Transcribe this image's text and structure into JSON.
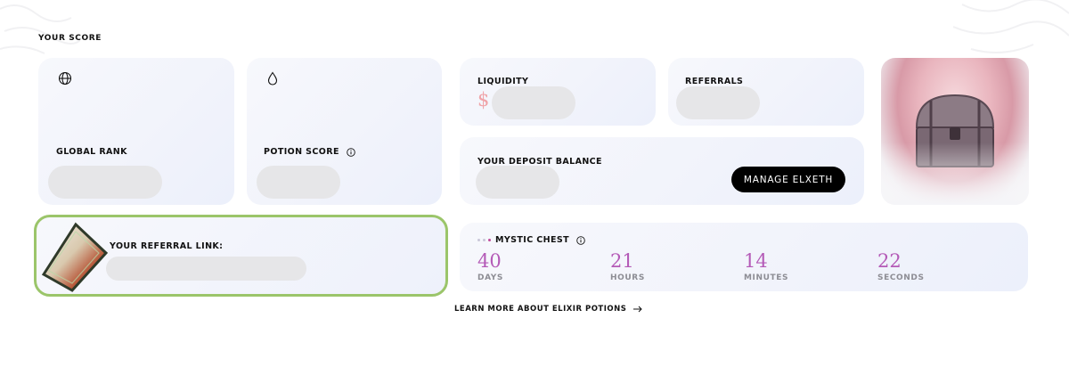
{
  "section_title": "YOUR SCORE",
  "global_rank": {
    "label": "GLOBAL RANK",
    "icon": "globe-icon"
  },
  "potion_score": {
    "label": "POTION SCORE",
    "icon": "droplet-icon",
    "info_icon": "info-icon"
  },
  "liquidity": {
    "label": "LIQUIDITY",
    "currency": "$"
  },
  "referrals": {
    "label": "REFERRALS"
  },
  "deposit": {
    "label": "YOUR DEPOSIT BALANCE",
    "button_label": "MANAGE ELXETH"
  },
  "referral_link": {
    "label": "YOUR REFERRAL LINK:"
  },
  "mystic_chest": {
    "title": "MYSTIC CHEST",
    "info_icon": "info-icon",
    "countdown": [
      {
        "value": "40",
        "unit": "DAYS"
      },
      {
        "value": "21",
        "unit": "HOURS"
      },
      {
        "value": "14",
        "unit": "MINUTES"
      },
      {
        "value": "22",
        "unit": "SECONDS"
      }
    ]
  },
  "learn_more": {
    "label": "LEARN MORE ABOUT ELIXIR POTIONS",
    "icon": "arrow-right-icon"
  },
  "colors": {
    "accent_border": "#9bc56a",
    "timer_number": "#b45ab7",
    "button_bg": "#000000"
  }
}
